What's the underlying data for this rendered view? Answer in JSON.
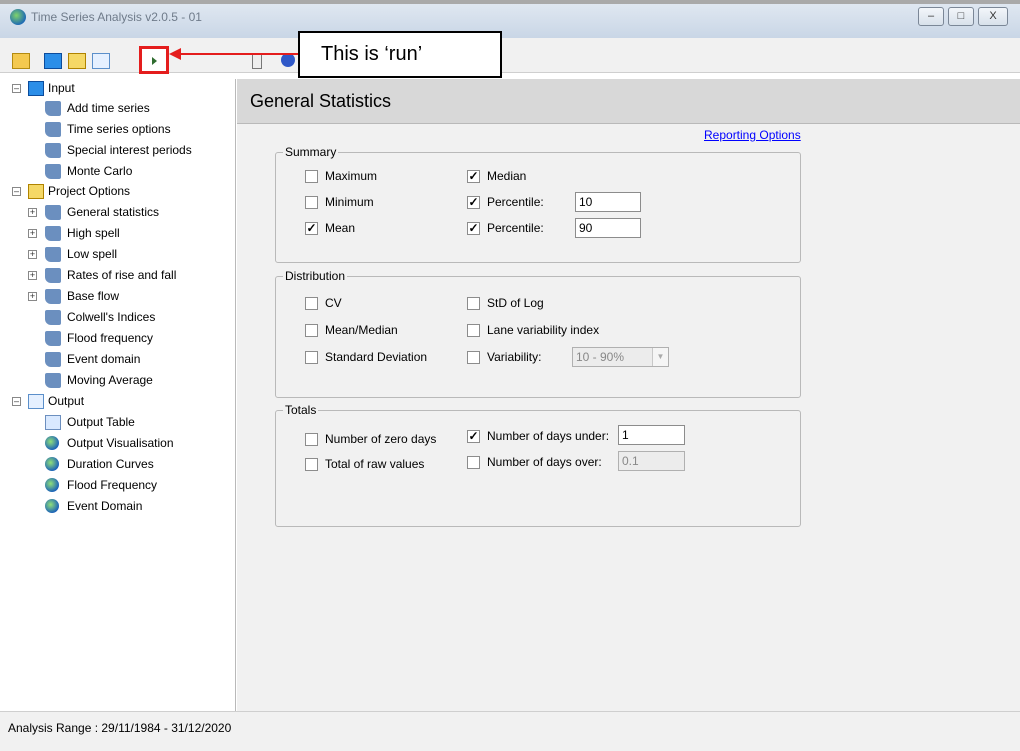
{
  "window": {
    "title": "Time Series Analysis v2.0.5 - 01",
    "controls": {
      "minimize": "–",
      "maximize": "□",
      "close": "X"
    }
  },
  "annotation": {
    "callout": "This is ‘run’",
    "color": "#e41d1d"
  },
  "tree": {
    "input": {
      "label": "Input",
      "expander": "–",
      "children": [
        {
          "label": "Add time series"
        },
        {
          "label": "Time series options"
        },
        {
          "label": "Special interest periods"
        },
        {
          "label": "Monte Carlo"
        }
      ]
    },
    "project_options": {
      "label": "Project Options",
      "expander": "–",
      "children": [
        {
          "label": "General statistics",
          "expander": "+"
        },
        {
          "label": "High spell",
          "expander": "+"
        },
        {
          "label": "Low spell",
          "expander": "+"
        },
        {
          "label": "Rates of rise and fall",
          "expander": "+"
        },
        {
          "label": "Base flow",
          "expander": "+"
        },
        {
          "label": "Colwell's Indices"
        },
        {
          "label": "Flood frequency"
        },
        {
          "label": "Event domain"
        },
        {
          "label": "Moving Average"
        }
      ]
    },
    "output": {
      "label": "Output",
      "expander": "–",
      "children": [
        {
          "label": "Output Table"
        },
        {
          "label": "Output Visualisation"
        },
        {
          "label": "Duration Curves"
        },
        {
          "label": "Flood Frequency"
        },
        {
          "label": "Event Domain"
        }
      ]
    }
  },
  "panel": {
    "title": "General Statistics",
    "reporting_link": "Reporting Options",
    "summary": {
      "legend": "Summary",
      "maximum": {
        "label": "Maximum",
        "mark": ""
      },
      "minimum": {
        "label": "Minimum",
        "mark": ""
      },
      "mean": {
        "label": "Mean",
        "mark": "✓"
      },
      "median": {
        "label": "Median",
        "mark": "✓"
      },
      "percentile_1": {
        "label": "Percentile:",
        "mark": "✓",
        "value": "10"
      },
      "percentile_2": {
        "label": "Percentile:",
        "mark": "✓",
        "value": "90"
      }
    },
    "distribution": {
      "legend": "Distribution",
      "cv": {
        "label": "CV",
        "mark": ""
      },
      "mean_median": {
        "label": "Mean/Median",
        "mark": ""
      },
      "std_dev": {
        "label": "Standard Deviation",
        "mark": ""
      },
      "std_log": {
        "label": "StD of Log",
        "mark": ""
      },
      "lane": {
        "label": "Lane variability index",
        "mark": ""
      },
      "variability": {
        "label": "Variability:",
        "mark": "",
        "value": "10 - 90%"
      }
    },
    "totals": {
      "legend": "Totals",
      "zero_days": {
        "label": "Number of zero days",
        "mark": ""
      },
      "raw_total": {
        "label": "Total of raw values",
        "mark": ""
      },
      "days_under": {
        "label": "Number of days under:",
        "mark": "✓",
        "value": "1"
      },
      "days_over": {
        "label": "Number of days over:",
        "mark": "",
        "value": "0.1"
      }
    }
  },
  "status": {
    "text": "Analysis Range : 29/11/1984 - 31/12/2020"
  }
}
